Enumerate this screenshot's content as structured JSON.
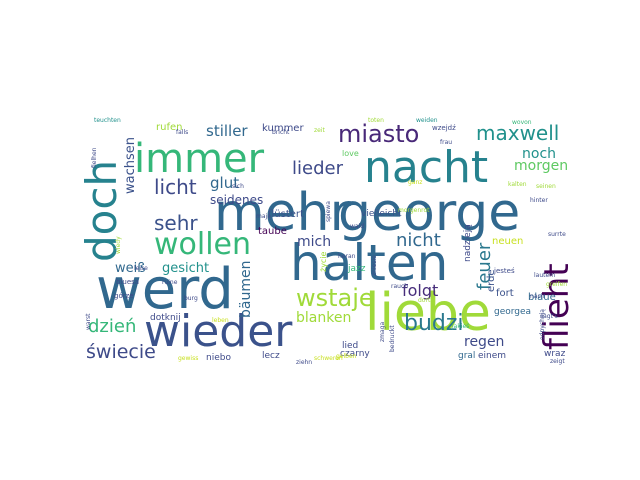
{
  "wordcloud": {
    "words": [
      {
        "text": "mehr",
        "color": "#31688e"
      },
      {
        "text": "george",
        "color": "#31688e"
      },
      {
        "text": "nacht",
        "color": "#26828e"
      },
      {
        "text": "halten",
        "color": "#31688e"
      },
      {
        "text": "werd",
        "color": "#31688e"
      },
      {
        "text": "liebe",
        "color": "#a0da39"
      },
      {
        "text": "wieder",
        "color": "#3b528b"
      },
      {
        "text": "immer",
        "color": "#35b779"
      },
      {
        "text": "doch",
        "color": "#26828e"
      },
      {
        "text": "flieht",
        "color": "#440154"
      },
      {
        "text": "wollen",
        "color": "#35b779"
      },
      {
        "text": "miasto",
        "color": "#482878"
      },
      {
        "text": "maxwell",
        "color": "#21918c"
      },
      {
        "text": "licht",
        "color": "#3e4a89"
      },
      {
        "text": "lieder",
        "color": "#3e4a89"
      },
      {
        "text": "wstaje",
        "color": "#a0da39"
      },
      {
        "text": "budzi",
        "color": "#2a788e"
      },
      {
        "text": "sehr",
        "color": "#3b528b"
      },
      {
        "text": "nicht",
        "color": "#31688e"
      },
      {
        "text": "feuer",
        "color": "#2a788e"
      },
      {
        "text": "mich",
        "color": "#3e4a89"
      },
      {
        "text": "folgt",
        "color": "#472d7b"
      },
      {
        "text": "świecie",
        "color": "#3e4a89"
      },
      {
        "text": "dzień",
        "color": "#35b779"
      },
      {
        "text": "stiller",
        "color": "#31688e"
      },
      {
        "text": "glut",
        "color": "#31688e"
      },
      {
        "text": "morgen",
        "color": "#5ec962"
      },
      {
        "text": "noch",
        "color": "#21918c"
      },
      {
        "text": "regen",
        "color": "#3e4a89"
      },
      {
        "text": "wachsen",
        "color": "#3b528b"
      },
      {
        "text": "blanken",
        "color": "#a0da39"
      },
      {
        "text": "bäumen",
        "color": "#31688e"
      },
      {
        "text": "gesicht",
        "color": "#21918c"
      },
      {
        "text": "weiß",
        "color": "#31688e"
      },
      {
        "text": "seidenes",
        "color": "#3e4a89"
      },
      {
        "text": "rufen",
        "color": "#a0da39"
      },
      {
        "text": "kummer",
        "color": "#3e4a89"
      },
      {
        "text": "taube",
        "color": "#440154"
      },
      {
        "text": "flüstert",
        "color": "#3b528b"
      },
      {
        "text": "vielleicht",
        "color": "#3b528b"
      },
      {
        "text": "erde",
        "color": "#3b528b"
      },
      {
        "text": "blaue",
        "color": "#31688e"
      },
      {
        "text": "neuen",
        "color": "#c8e020"
      },
      {
        "text": "fort",
        "color": "#3b528b"
      },
      {
        "text": "georgea",
        "color": "#31688e"
      },
      {
        "text": "wraz",
        "color": "#3e4a89"
      },
      {
        "text": "einem",
        "color": "#3e4a89"
      },
      {
        "text": "gral",
        "color": "#31688e"
      },
      {
        "text": "lied",
        "color": "#3e4a89"
      },
      {
        "text": "czarny",
        "color": "#3e4a89"
      },
      {
        "text": "lecz",
        "color": "#3e4a89"
      },
      {
        "text": "niebo",
        "color": "#3e4a89"
      },
      {
        "text": "dotknij",
        "color": "#3e4a89"
      },
      {
        "text": "nadzieją",
        "color": "#3e4a89"
      },
      {
        "text": "życie",
        "color": "#a0da39"
      },
      {
        "text": "jazz",
        "color": "#35b779"
      },
      {
        "text": "love",
        "color": "#5ec962"
      },
      {
        "text": "zeit",
        "color": "#a0da39"
      },
      {
        "text": "bricht",
        "color": "#3e4a89"
      },
      {
        "text": "wzejdź",
        "color": "#3e4a89"
      },
      {
        "text": "frau",
        "color": "#3e4a89"
      },
      {
        "text": "ganz",
        "color": "#c8e020"
      },
      {
        "text": "falls",
        "color": "#3e4a89"
      },
      {
        "text": "jakieś",
        "color": "#35b779"
      },
      {
        "text": "jesteś",
        "color": "#3e4a89"
      },
      {
        "text": "bluesa",
        "color": "#3e4a89"
      },
      {
        "text": "górze",
        "color": "#3e4a89"
      },
      {
        "text": "leise",
        "color": "#3e4a89"
      },
      {
        "text": "wiedy",
        "color": "#a0da39"
      },
      {
        "text": "ruine",
        "color": "#3e4a89"
      },
      {
        "text": "mają",
        "color": "#3e4a89"
      },
      {
        "text": "sich",
        "color": "#3e4a89"
      },
      {
        "text": "wald",
        "color": "#3e4a89"
      },
      {
        "text": "heran",
        "color": "#3e4a89"
      },
      {
        "text": "zniesie",
        "color": "#3e4a89"
      },
      {
        "text": "spiewa",
        "color": "#3e4a89"
      },
      {
        "text": "rauch",
        "color": "#3e4a89"
      },
      {
        "text": "dort",
        "color": "#a0da39"
      },
      {
        "text": "nach",
        "color": "#3e4a89"
      },
      {
        "text": "sagt's",
        "color": "#3e4a89"
      },
      {
        "text": "zeigt",
        "color": "#3e4a89"
      },
      {
        "text": "ziehn",
        "color": "#3e4a89"
      },
      {
        "text": "zmaga",
        "color": "#3e4a89"
      },
      {
        "text": "bedruckt",
        "color": "#3e4a89"
      },
      {
        "text": "odpychają",
        "color": "#3e4a89"
      },
      {
        "text": "greifen",
        "color": "#a0da39"
      },
      {
        "text": "lautem",
        "color": "#3e4a89"
      },
      {
        "text": "seinen",
        "color": "#a0da39"
      },
      {
        "text": "hinter",
        "color": "#3e4a89"
      },
      {
        "text": "kalten",
        "color": "#a0da39"
      },
      {
        "text": "gelben",
        "color": "#c8e020"
      },
      {
        "text": "schweren",
        "color": "#c8e020"
      },
      {
        "text": "gewiss",
        "color": "#c8e020"
      },
      {
        "text": "leben",
        "color": "#c8e020"
      },
      {
        "text": "burg",
        "color": "#3e4a89"
      },
      {
        "text": "fielhen",
        "color": "#3e4a89"
      },
      {
        "text": "teuchten",
        "color": "#21918c"
      },
      {
        "text": "toten",
        "color": "#a0da39"
      },
      {
        "text": "weiden",
        "color": "#21918c"
      },
      {
        "text": "wovon",
        "color": "#35b779"
      },
      {
        "text": "warst",
        "color": "#3e4a89"
      },
      {
        "text": "surrte",
        "color": "#3e4a89"
      },
      {
        "text": "morgenrot",
        "color": "#a0da39"
      }
    ]
  }
}
